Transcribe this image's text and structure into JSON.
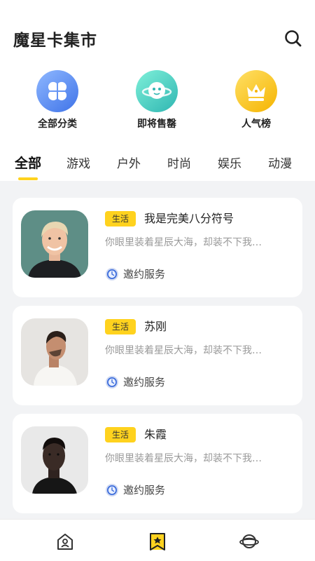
{
  "header": {
    "title": "魔星卡集市"
  },
  "categories": [
    {
      "label": "全部分类",
      "icon": "clover-icon",
      "color": "#4f82ee"
    },
    {
      "label": "即将售罄",
      "icon": "planet-icon",
      "color": "#3cc2bb"
    },
    {
      "label": "人气榜",
      "icon": "crown-icon",
      "color": "#f7c21a"
    }
  ],
  "tabs": [
    {
      "label": "全部",
      "active": true
    },
    {
      "label": "游戏"
    },
    {
      "label": "户外"
    },
    {
      "label": "时尚"
    },
    {
      "label": "娱乐"
    },
    {
      "label": "动漫"
    }
  ],
  "cards": [
    {
      "badge": "生活",
      "name": "我是完美八分符号",
      "desc": "你眼里装着星辰大海，却装不下我…",
      "service": "邀约服务"
    },
    {
      "badge": "生活",
      "name": "苏刚",
      "desc": "你眼里装着星辰大海，却装不下我…",
      "service": "邀约服务"
    },
    {
      "badge": "生活",
      "name": "朱霞",
      "desc": "你眼里装着星辰大海，却装不下我…",
      "service": "邀约服务"
    }
  ],
  "tabbar": {
    "items": [
      {
        "icon": "home-icon"
      },
      {
        "icon": "bookmark-star-icon",
        "active": true
      },
      {
        "icon": "planet-icon"
      }
    ]
  },
  "colors": {
    "accent": "#ffd21e",
    "background": "#f2f3f5"
  }
}
